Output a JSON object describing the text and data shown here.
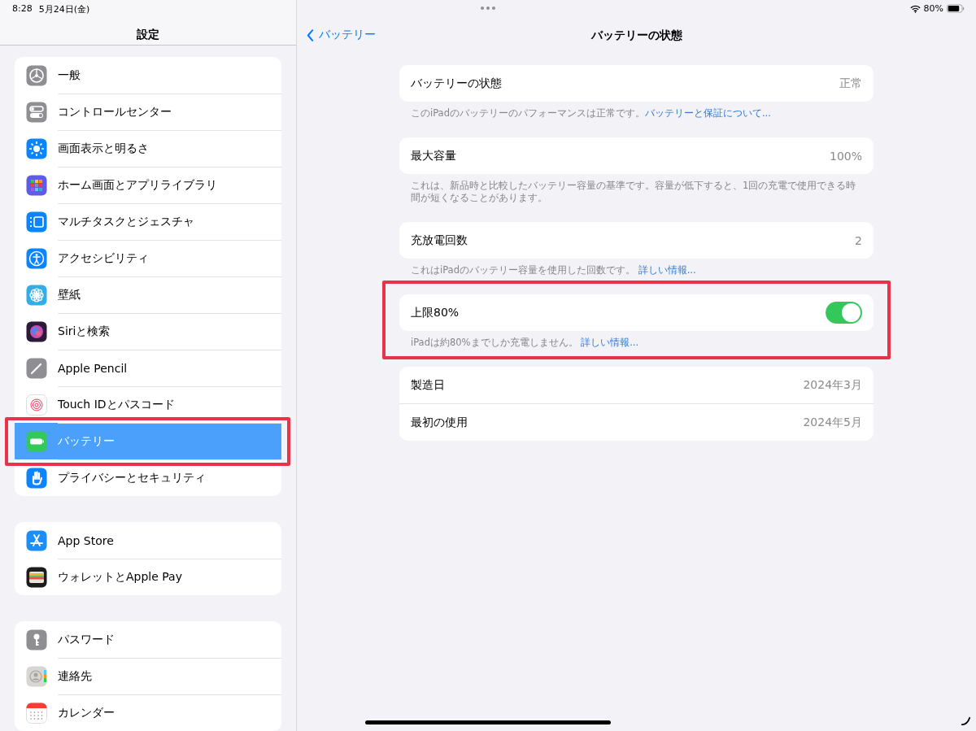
{
  "status_bar": {
    "time": "8:28",
    "date": "5月24日(金)",
    "battery_text": "80%"
  },
  "sidebar": {
    "title": "設定",
    "groups": [
      {
        "items": [
          {
            "label": "一般",
            "selected": false,
            "annotated": false
          },
          {
            "label": "コントロールセンター",
            "selected": false,
            "annotated": false
          },
          {
            "label": "画面表示と明るさ",
            "selected": false,
            "annotated": false
          },
          {
            "label": "ホーム画面とアプリライブラリ",
            "selected": false,
            "annotated": false
          },
          {
            "label": "マルチタスクとジェスチャ",
            "selected": false,
            "annotated": false
          },
          {
            "label": "アクセシビリティ",
            "selected": false,
            "annotated": false
          },
          {
            "label": "壁紙",
            "selected": false,
            "annotated": false
          },
          {
            "label": "Siriと検索",
            "selected": false,
            "annotated": false
          },
          {
            "label": "Apple Pencil",
            "selected": false,
            "annotated": false
          },
          {
            "label": "Touch IDとパスコード",
            "selected": false,
            "annotated": false
          },
          {
            "label": "バッテリー",
            "selected": true,
            "annotated": true
          },
          {
            "label": "プライバシーとセキュリティ",
            "selected": false,
            "annotated": false
          }
        ]
      },
      {
        "items": [
          {
            "label": "App Store",
            "selected": false,
            "annotated": false
          },
          {
            "label": "ウォレットとApple Pay",
            "selected": false,
            "annotated": false
          }
        ]
      },
      {
        "items": [
          {
            "label": "パスワード",
            "selected": false,
            "annotated": false
          },
          {
            "label": "連絡先",
            "selected": false,
            "annotated": false
          },
          {
            "label": "カレンダー",
            "selected": false,
            "annotated": false
          }
        ]
      }
    ]
  },
  "detail": {
    "back_label": "バッテリー",
    "title": "バッテリーの状態",
    "sections": [
      {
        "kind": "value",
        "annotated": false,
        "rows": [
          {
            "label": "バッテリーの状態",
            "value": "正常"
          }
        ],
        "footer": {
          "text": "このiPadのバッテリーのパフォーマンスは正常です。",
          "link": "バッテリーと保証について..."
        }
      },
      {
        "kind": "value",
        "annotated": false,
        "rows": [
          {
            "label": "最大容量",
            "value": "100%"
          }
        ],
        "footer": {
          "text": "これは、新品時と比較したバッテリー容量の基準です。容量が低下すると、1回の充電で使用できる時間が短くなることがあります。"
        }
      },
      {
        "kind": "value",
        "annotated": false,
        "rows": [
          {
            "label": "充放電回数",
            "value": "2"
          }
        ],
        "footer": {
          "text": "これはiPadのバッテリー容量を使用した回数です。 ",
          "link": "詳しい情報..."
        }
      },
      {
        "kind": "toggle",
        "annotated": true,
        "label": "上限80%",
        "on": true,
        "footer": {
          "text": "iPadは約80%までしか充電しません。 ",
          "link": "詳しい情報..."
        }
      },
      {
        "kind": "value",
        "annotated": false,
        "rows": [
          {
            "label": "製造日",
            "value": "2024年3月"
          },
          {
            "label": "最初の使用",
            "value": "2024年5月"
          }
        ]
      }
    ]
  }
}
